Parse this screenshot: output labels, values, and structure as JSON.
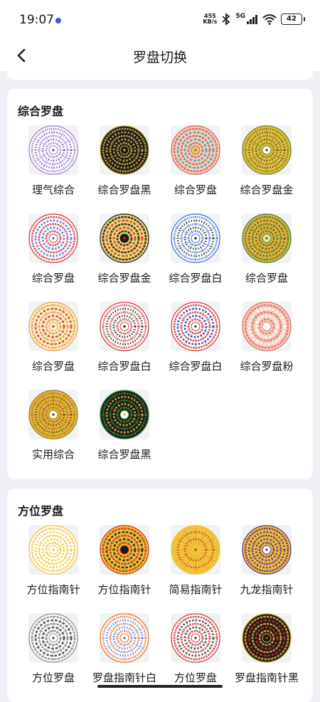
{
  "status_bar": {
    "time": "19:07",
    "net_speed_value": "455",
    "net_speed_unit": "KB/s",
    "network": "5G",
    "battery": "42"
  },
  "nav": {
    "title": "罗盘切换"
  },
  "sections": [
    {
      "title": "综合罗盘",
      "items": [
        {
          "label": "理气综合",
          "bg": "#ffffff",
          "ring": "#9a7cc9",
          "accent": "#6a3fb8",
          "center": "#ffffff"
        },
        {
          "label": "综合罗盘黑",
          "bg": "#1a1a1a",
          "ring": "#d9b64a",
          "accent": "#d9b64a",
          "center": "#1a1a1a"
        },
        {
          "label": "综合罗盘",
          "bg": "#f3d6b3",
          "ring": "#d85a66",
          "accent": "#3a8fd6",
          "center": "#f7c64a"
        },
        {
          "label": "综合罗盘金",
          "bg": "#e6c23b",
          "ring": "#6a7a1f",
          "accent": "#3a3a3a",
          "center": "#ffffff"
        },
        {
          "label": "综合罗盘",
          "bg": "#ffffff",
          "ring": "#d6333a",
          "accent": "#3a6fd6",
          "center": "#ffffff"
        },
        {
          "label": "综合罗盘金",
          "bg": "#f1d77a",
          "ring": "#1a1a1a",
          "accent": "#c9341e",
          "center": "#1a1a1a"
        },
        {
          "label": "综合罗盘白",
          "bg": "#ffffff",
          "ring": "#3a6fd6",
          "accent": "#1a1a1a",
          "center": "#ffffff"
        },
        {
          "label": "综合罗盘",
          "bg": "#e6b43a",
          "ring": "#3a7a3a",
          "accent": "#5a5a2a",
          "center": "#f3e2a0"
        },
        {
          "label": "综合罗盘",
          "bg": "#fbf1c8",
          "ring": "#e6a34a",
          "accent": "#d6333a",
          "center": "#fbf1c8"
        },
        {
          "label": "综合罗盘白",
          "bg": "#ffffff",
          "ring": "#d6333a",
          "accent": "#1a1a1a",
          "center": "#ffffff"
        },
        {
          "label": "综合罗盘白",
          "bg": "#ffffff",
          "ring": "#d6333a",
          "accent": "#1a3a9a",
          "center": "#ffffff"
        },
        {
          "label": "综合罗盘粉",
          "bg": "#f7d0c6",
          "ring": "#e06a5a",
          "accent": "#ffffff",
          "center": "#ffffff"
        },
        {
          "label": "实用综合",
          "bg": "#e6b43a",
          "ring": "#a07a1a",
          "accent": "#5a3a0a",
          "center": "#ffffff"
        },
        {
          "label": "综合罗盘黑",
          "bg": "#1a1a1a",
          "ring": "#3a8a3a",
          "accent": "#e6c23b",
          "center": "#ffffff"
        }
      ]
    },
    {
      "title": "方位罗盘",
      "items": [
        {
          "label": "方位指南针",
          "bg": "#ffffff",
          "ring": "#f0c23a",
          "accent": "#f0c23a",
          "center": "#ffffff"
        },
        {
          "label": "方位指南针",
          "bg": "#f0c23a",
          "ring": "#c9341e",
          "accent": "#1a1a1a",
          "center": "#1a1a1a"
        },
        {
          "label": "简易指南针",
          "bg": "#f0c23a",
          "ring": "#f0c23a",
          "accent": "#c9341e",
          "center": "#f0c23a"
        },
        {
          "label": "九龙指南针",
          "bg": "#f0c23a",
          "ring": "#5a2a8a",
          "accent": "#5a2a8a",
          "center": "#ffffff"
        },
        {
          "label": "方位罗盘",
          "bg": "#ffffff",
          "ring": "#8a8a8a",
          "accent": "#3a3a3a",
          "center": "#ffffff"
        },
        {
          "label": "罗盘指南针白",
          "bg": "#ffffff",
          "ring": "#e06a2a",
          "accent": "#3a6fd6",
          "center": "#ffffff"
        },
        {
          "label": "方位罗盘",
          "bg": "#ffffff",
          "ring": "#d6333a",
          "accent": "#3a3a3a",
          "center": "#ffffff"
        },
        {
          "label": "罗盘指南针黑",
          "bg": "#1a1a1a",
          "ring": "#e6b43a",
          "accent": "#d6333a",
          "center": "#1a1a1a"
        }
      ]
    }
  ]
}
